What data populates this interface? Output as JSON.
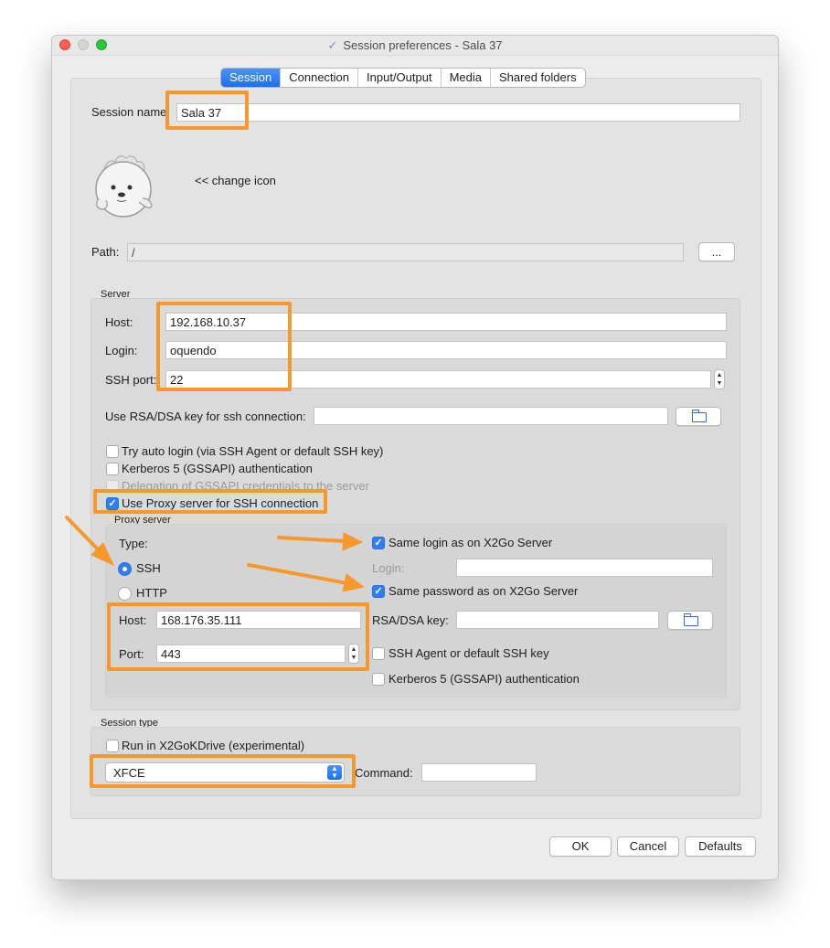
{
  "window": {
    "title": "Session preferences - Sala 37"
  },
  "tabs": [
    {
      "label": "Session",
      "active": true
    },
    {
      "label": "Connection"
    },
    {
      "label": "Input/Output"
    },
    {
      "label": "Media"
    },
    {
      "label": "Shared folders"
    }
  ],
  "session": {
    "name_label": "Session name",
    "name_value": "Sala 37",
    "change_icon_label": "<< change icon",
    "path_label": "Path:",
    "path_value": "/",
    "browse_label": "..."
  },
  "server": {
    "group_title": "Server",
    "host_label": "Host:",
    "host_value": "192.168.10.37",
    "login_label": "Login:",
    "login_value": "oquendo",
    "port_label": "SSH port:",
    "port_value": "22",
    "rsa_label": "Use RSA/DSA key for ssh connection:",
    "rsa_value": "",
    "auto_login": {
      "label": "Try auto login (via SSH Agent or default SSH key)",
      "checked": false
    },
    "kerberos": {
      "label": "Kerberos 5 (GSSAPI) authentication",
      "checked": false
    },
    "delegation": {
      "label": "Delegation of GSSAPI credentials to the server",
      "checked": false,
      "disabled": true
    },
    "use_proxy": {
      "label": "Use Proxy server for SSH connection",
      "checked": true
    }
  },
  "proxy": {
    "group_title": "Proxy server",
    "type_label": "Type:",
    "ssh_label": "SSH",
    "http_label": "HTTP",
    "selected_type": "SSH",
    "host_label": "Host:",
    "host_value": "168.176.35.111",
    "port_label": "Port:",
    "port_value": "443",
    "same_login": {
      "label": "Same login as on X2Go Server",
      "checked": true
    },
    "login_label": "Login:",
    "login_value": "",
    "same_password": {
      "label": "Same password as on X2Go Server",
      "checked": true
    },
    "rsa_label": "RSA/DSA key:",
    "rsa_value": "",
    "ssh_agent": {
      "label": "SSH Agent or default SSH key",
      "checked": false
    },
    "kerberos": {
      "label": "Kerberos 5 (GSSAPI) authentication",
      "checked": false
    }
  },
  "session_type": {
    "group_title": "Session type",
    "kdrive": {
      "label": "Run in X2GoKDrive (experimental)",
      "checked": false
    },
    "selected": "XFCE",
    "command_label": "Command:",
    "command_value": ""
  },
  "footer": {
    "ok_label": "OK",
    "cancel_label": "Cancel",
    "defaults_label": "Defaults"
  },
  "colors": {
    "accent": "#2f7ef5",
    "highlight": "#f7982d"
  }
}
